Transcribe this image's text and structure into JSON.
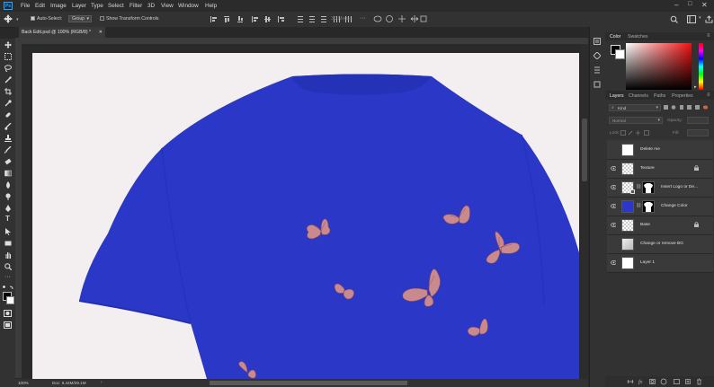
{
  "app": {
    "logo": "Ps"
  },
  "menu": [
    "File",
    "Edit",
    "Image",
    "Layer",
    "Type",
    "Select",
    "Filter",
    "3D",
    "View",
    "Window",
    "Help"
  ],
  "options": {
    "auto_select": "Auto-Select:",
    "group": "Group",
    "show_transform": "Show Transform Controls",
    "mode_3d": "3D Mode:"
  },
  "document": {
    "tab_title": "Back Edit.psd @ 100% (RGB/8) *",
    "zoom": "100%",
    "doc_size": "Doc: 6.44M/29.1M"
  },
  "panels": {
    "color_tabs": [
      "Color",
      "Swatches"
    ],
    "layers_tabs": [
      "Layers",
      "Channels",
      "Paths",
      "Properties"
    ],
    "kind": "Kind",
    "blend_mode": "Normal",
    "opacity_label": "Opacity:",
    "fill_label": "Fill:",
    "lock_label": "Lock:"
  },
  "layers": [
    {
      "name": "Delete me",
      "visible": false,
      "thumb": "white",
      "lock": false
    },
    {
      "name": "Texture",
      "visible": true,
      "thumb": "checker",
      "lock": true
    },
    {
      "name": "Insert Logo or De...",
      "visible": true,
      "thumb": "checker-mask",
      "lock": false
    },
    {
      "name": "Change Color",
      "visible": true,
      "thumb": "blue-mask",
      "lock": false
    },
    {
      "name": "Base",
      "visible": true,
      "thumb": "checker",
      "lock": true
    },
    {
      "name": "Change or remove BG",
      "visible": false,
      "thumb": "grey",
      "lock": false
    },
    {
      "name": "Layer 1",
      "visible": true,
      "thumb": "white",
      "lock": false
    }
  ],
  "colors": {
    "shirt": "#2b37c7",
    "canvas": "#f3eff1",
    "butterfly": "#c98a8f",
    "accent": "#31a8ff"
  }
}
